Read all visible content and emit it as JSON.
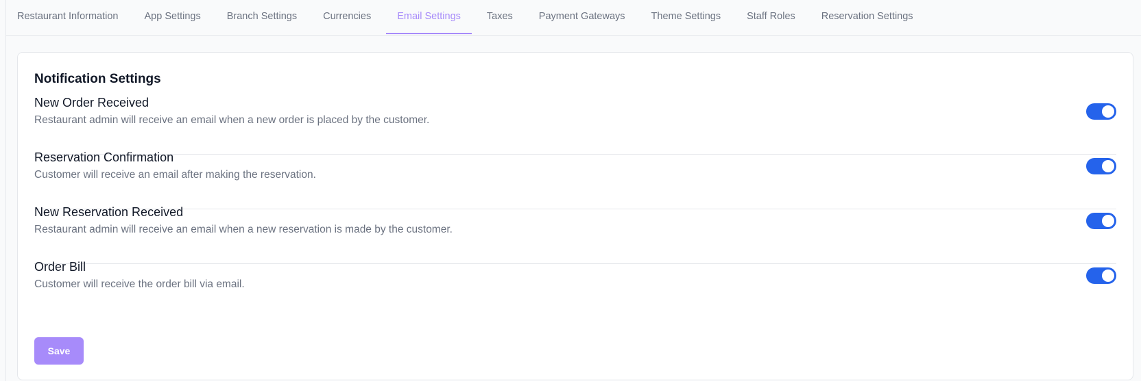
{
  "tabs": [
    {
      "label": "Restaurant Information"
    },
    {
      "label": "App Settings"
    },
    {
      "label": "Branch Settings"
    },
    {
      "label": "Currencies"
    },
    {
      "label": "Email Settings",
      "active": true
    },
    {
      "label": "Taxes"
    },
    {
      "label": "Payment Gateways"
    },
    {
      "label": "Theme Settings"
    },
    {
      "label": "Staff Roles"
    },
    {
      "label": "Reservation Settings"
    }
  ],
  "card": {
    "title": "Notification Settings",
    "settings": [
      {
        "title": "New Order Received",
        "description": "Restaurant admin will receive an email when a new order is placed by the customer.",
        "enabled": true
      },
      {
        "title": "Reservation Confirmation",
        "description": "Customer will receive an email after making the reservation.",
        "enabled": true
      },
      {
        "title": "New Reservation Received",
        "description": "Restaurant admin will receive an email when a new reservation is made by the customer.",
        "enabled": true
      },
      {
        "title": "Order Bill",
        "description": "Customer will receive the order bill via email.",
        "enabled": true
      }
    ],
    "save_label": "Save"
  },
  "colors": {
    "accent": "#a78bfa",
    "toggle_on": "#2563eb",
    "text_primary": "#111827",
    "text_secondary": "#6b7280"
  }
}
